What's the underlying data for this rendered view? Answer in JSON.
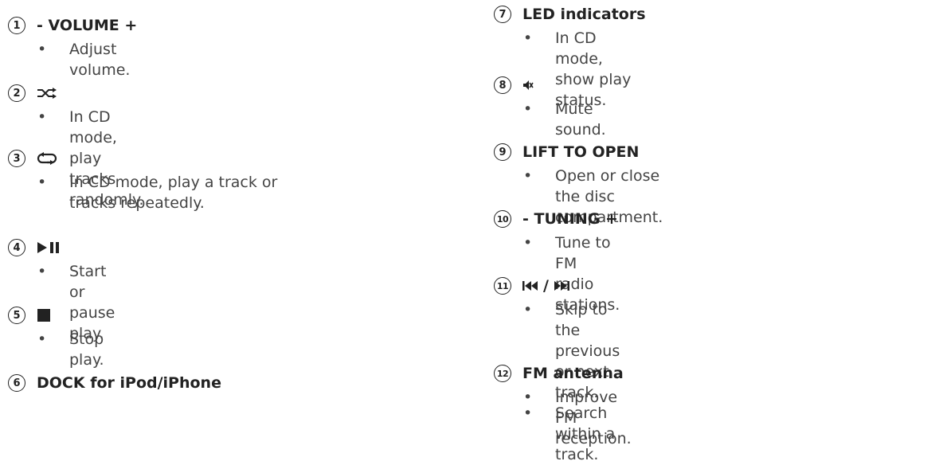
{
  "items": [
    {
      "number": "1",
      "title": "- VOLUME +",
      "bullets": [
        "Adjust volume."
      ]
    },
    {
      "number": "2",
      "icon": "shuffle-icon",
      "bullets": [
        "In CD mode, play tracks randomly."
      ]
    },
    {
      "number": "3",
      "icon": "repeat-icon",
      "bullets": [
        "In CD mode, play a track or tracks repeatedly."
      ]
    },
    {
      "number": "4",
      "icon": "play-pause-icon",
      "bullets": [
        "Start or pause play."
      ]
    },
    {
      "number": "5",
      "icon": "stop-icon",
      "bullets": [
        "Stop play."
      ]
    },
    {
      "number": "6",
      "title": "DOCK for iPod/iPhone",
      "bullets": []
    },
    {
      "number": "7",
      "title": "LED indicators",
      "bullets": [
        "In CD mode, show play status."
      ]
    },
    {
      "number": "8",
      "icon": "mute-icon",
      "bullets": [
        "Mute sound."
      ]
    },
    {
      "number": "9",
      "title": "LIFT TO OPEN",
      "bullets": [
        "Open or close the disc compartment."
      ]
    },
    {
      "number": "10",
      "title": "- TUNING +",
      "bullets": [
        "Tune to FM radio stations."
      ]
    },
    {
      "number": "11",
      "title": "/",
      "icon": "prev-next-icon",
      "bullets": [
        "Skip to the previous or next track.",
        "Search within a track."
      ]
    },
    {
      "number": "12",
      "title": "FM antenna",
      "bullets": [
        "Improve FM reception."
      ]
    }
  ]
}
